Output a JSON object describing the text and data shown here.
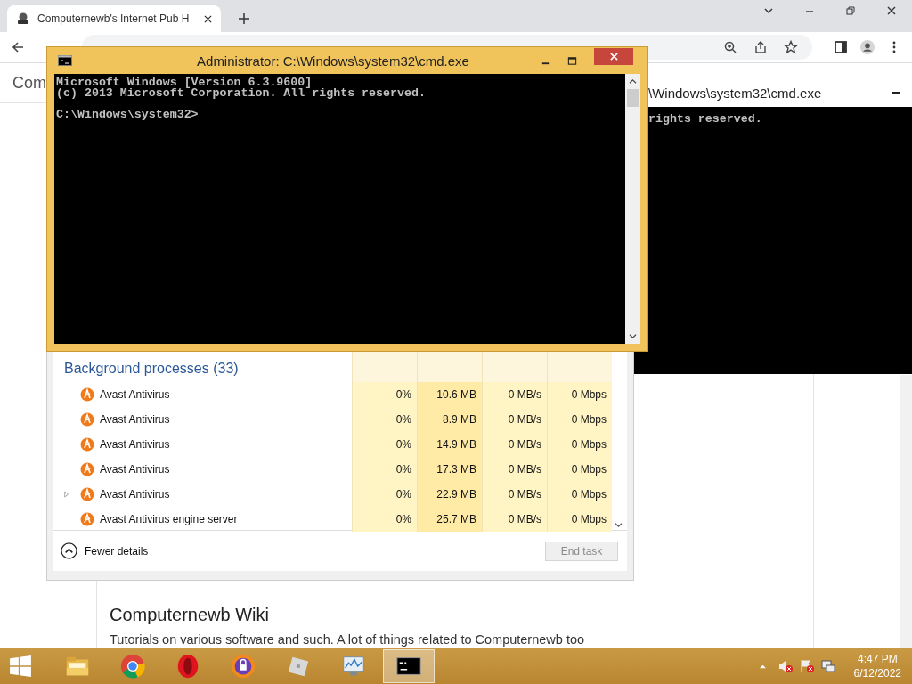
{
  "browser": {
    "tab": {
      "title": "Computernewb's Internet Pub H"
    },
    "page": {
      "header": "Com",
      "heading": "Computernewb Wiki",
      "intro": "Tutorials on various software and such. A lot of things related to Computernewb too"
    }
  },
  "cmd_back": {
    "title": "\\Windows\\system32\\cmd.exe",
    "lines": [
      "rights reserved."
    ]
  },
  "task_manager": {
    "group": "Background processes (33)",
    "rows": [
      {
        "name": "Avast Antivirus",
        "cpu": "0%",
        "memory": "10.6 MB",
        "disk": "0 MB/s",
        "network": "0 Mbps",
        "expandable": false
      },
      {
        "name": "Avast Antivirus",
        "cpu": "0%",
        "memory": "8.9 MB",
        "disk": "0 MB/s",
        "network": "0 Mbps",
        "expandable": false
      },
      {
        "name": "Avast Antivirus",
        "cpu": "0%",
        "memory": "14.9 MB",
        "disk": "0 MB/s",
        "network": "0 Mbps",
        "expandable": false
      },
      {
        "name": "Avast Antivirus",
        "cpu": "0%",
        "memory": "17.3 MB",
        "disk": "0 MB/s",
        "network": "0 Mbps",
        "expandable": false
      },
      {
        "name": "Avast Antivirus",
        "cpu": "0%",
        "memory": "22.9 MB",
        "disk": "0 MB/s",
        "network": "0 Mbps",
        "expandable": true
      },
      {
        "name": "Avast Antivirus engine server",
        "cpu": "0%",
        "memory": "25.7 MB",
        "disk": "0 MB/s",
        "network": "0 Mbps",
        "expandable": false
      }
    ],
    "footer": {
      "toggle": "Fewer details",
      "end_task": "End task",
      "end_task_disabled": true
    }
  },
  "cmd_front": {
    "title": "Administrator: C:\\Windows\\system32\\cmd.exe",
    "banner": [
      "Microsoft Windows [Version 6.3.9600]",
      "(c) 2013 Microsoft Corporation. All rights reserved."
    ],
    "prompt": "C:\\Windows\\system32>"
  },
  "taskbar": {
    "apps": [
      {
        "kind": "explorer",
        "active": false
      },
      {
        "kind": "chrome",
        "active": false
      },
      {
        "kind": "opera",
        "active": false
      },
      {
        "kind": "secure-browser",
        "active": false
      },
      {
        "kind": "roblox",
        "active": false
      },
      {
        "kind": "monitor",
        "active": false
      },
      {
        "kind": "console",
        "active": true
      }
    ],
    "clock": {
      "time": "4:47 PM",
      "date": "6/12/2022"
    }
  }
}
